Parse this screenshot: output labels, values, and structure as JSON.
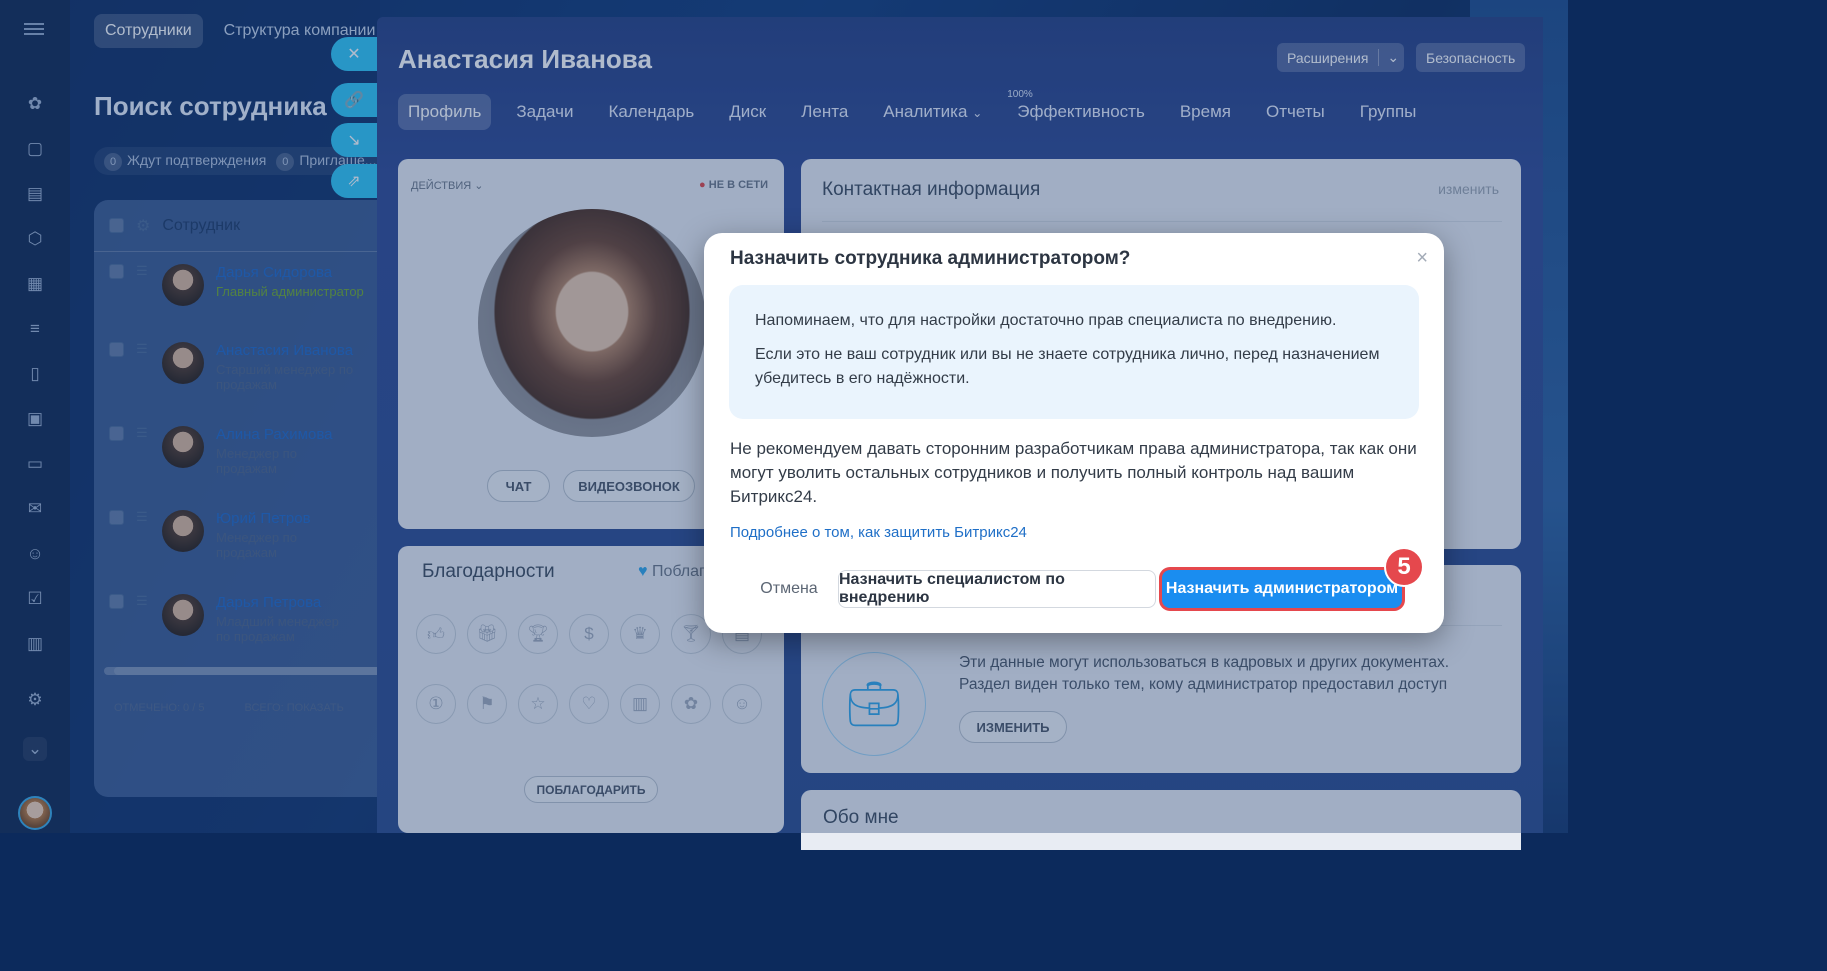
{
  "top_tabs": [
    "Сотрудники",
    "Структура компании"
  ],
  "page_title": "Поиск сотрудника",
  "counters": [
    {
      "n": "0",
      "label": "Ждут подтверждения"
    },
    {
      "n": "0",
      "label": "Приглаше..."
    }
  ],
  "table": {
    "header": "Сотрудник",
    "rows": [
      {
        "name": "Дарья Сидорова",
        "position": "Главный администратор"
      },
      {
        "name": "Анастасия Иванова",
        "position": "Старший менеджер по продажам"
      },
      {
        "name": "Алина Рахимова",
        "position": "Менеджер по продажам"
      },
      {
        "name": "Юрий Петров",
        "position": "Менеджер по продажам"
      },
      {
        "name": "Дарья Петрова",
        "position": "Младший менеджер по продажам"
      }
    ],
    "footer_selected": "ОТМЕЧЕНО: 0 / 5",
    "footer_total": "ВСЕГО: ПОКАЗАТЬ"
  },
  "profile": {
    "name": "Анастасия Иванова",
    "extensions": "Расширения",
    "security": "Безопасность",
    "menu": [
      "Профиль",
      "Задачи",
      "Календарь",
      "Диск",
      "Лента",
      "Аналитика",
      "Эффективность",
      "Время",
      "Отчеты",
      "Группы"
    ],
    "efficiency_sup": "100%",
    "actions": "ДЕЙСТВИЯ",
    "status": "НЕ В СЕТИ",
    "chat": "ЧАТ",
    "video": "ВИДЕОЗВОНОК",
    "contact_title": "Контактная информация",
    "contact_edit": "изменить",
    "thanks_title": "Благодарности",
    "thanks_action": "Поблагод...",
    "thanks_button": "ПОБЛАГОДАРИТЬ",
    "hr_text": "Эти данные могут использоваться в кадровых и других документах. Раздел виден только тем, кому администратор предоставил доступ",
    "hr_button": "ИЗМЕНИТЬ",
    "about_title": "Обо мне"
  },
  "dialog": {
    "title": "Назначить сотрудника администратором?",
    "info_1": "Напоминаем, что для настройки достаточно прав специалиста по внедрению.",
    "info_2": "Если это не ваш сотрудник или вы не знаете сотрудника лично, перед назначением убедитесь в его надёжности.",
    "warning": "Не рекомендуем давать сторонним разработчикам права администратора, так как они могут уволить остальных сотрудников и получить полный контроль над вашим Битрикс24.",
    "link": "Подробнее о том, как защитить Битрикс24",
    "cancel": "Отмена",
    "assign_specialist": "Назначить специалистом по внедрению",
    "assign_admin": "Назначить администратором"
  },
  "step_badge": "5",
  "colors": {
    "accent": "#1a8df0",
    "step": "#e5484d",
    "brand": "#2fc6f6"
  }
}
